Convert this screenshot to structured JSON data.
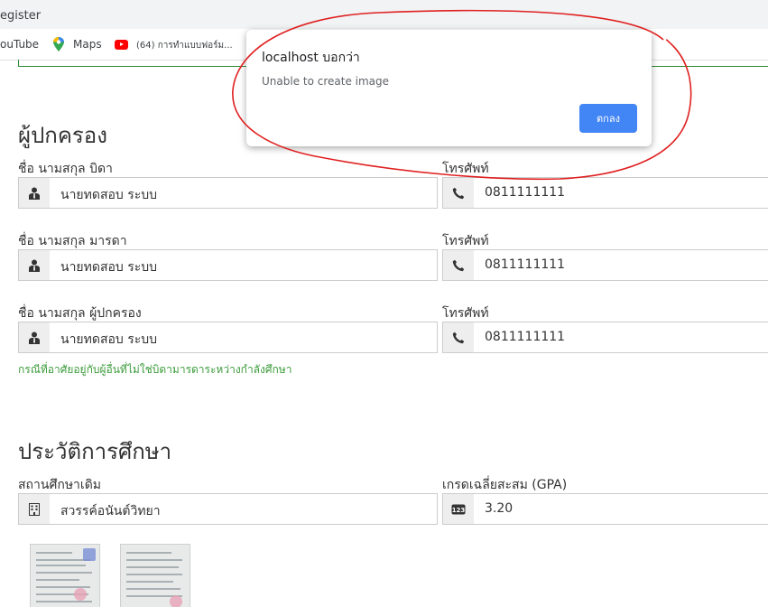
{
  "browser": {
    "tab_title": "egister",
    "bookmarks": [
      {
        "label": "ouTube",
        "icon": "youtube-icon"
      },
      {
        "label": "Maps",
        "icon": "maps-pin-icon"
      },
      {
        "label": "(64) การทำแบบฟอร์ม...",
        "icon": "youtube-play-icon"
      }
    ]
  },
  "dialog": {
    "title": "localhost บอกว่า",
    "message": "Unable to create image",
    "ok_label": "ตกลง"
  },
  "guardian_section": {
    "title": "ผู้ปกครอง",
    "rows": [
      {
        "name_label": "ชื่อ นามสกุล บิดา",
        "name_value": "นายทดสอบ ระบบ",
        "phone_label": "โทรศัพท์",
        "phone_value": "0811111111"
      },
      {
        "name_label": "ชื่อ นามสกุล มารดา",
        "name_value": "นายทดสอบ ระบบ",
        "phone_label": "โทรศัพท์",
        "phone_value": "0811111111"
      },
      {
        "name_label": "ชื่อ นามสกุล ผู้ปกครอง",
        "name_value": "นายทดสอบ ระบบ",
        "phone_label": "โทรศัพท์",
        "phone_value": "0811111111"
      }
    ],
    "hint": "กรณีที่อาศัยอยู่กับผู้อื่นที่ไม่ใช่บิดามารดาระหว่างกำลังศึกษา"
  },
  "education_section": {
    "title": "ประวัติการศึกษา",
    "school_label": "สถานศึกษาเดิม",
    "school_value": "สวรรค์อนันต์วิทยา",
    "gpa_label": "เกรดเฉลี่ยสะสม (GPA)",
    "gpa_value": "3.20"
  },
  "colors": {
    "accent_green": "#3c9c3c",
    "ok_blue": "#4285f4",
    "annotation_red": "#e02020"
  }
}
